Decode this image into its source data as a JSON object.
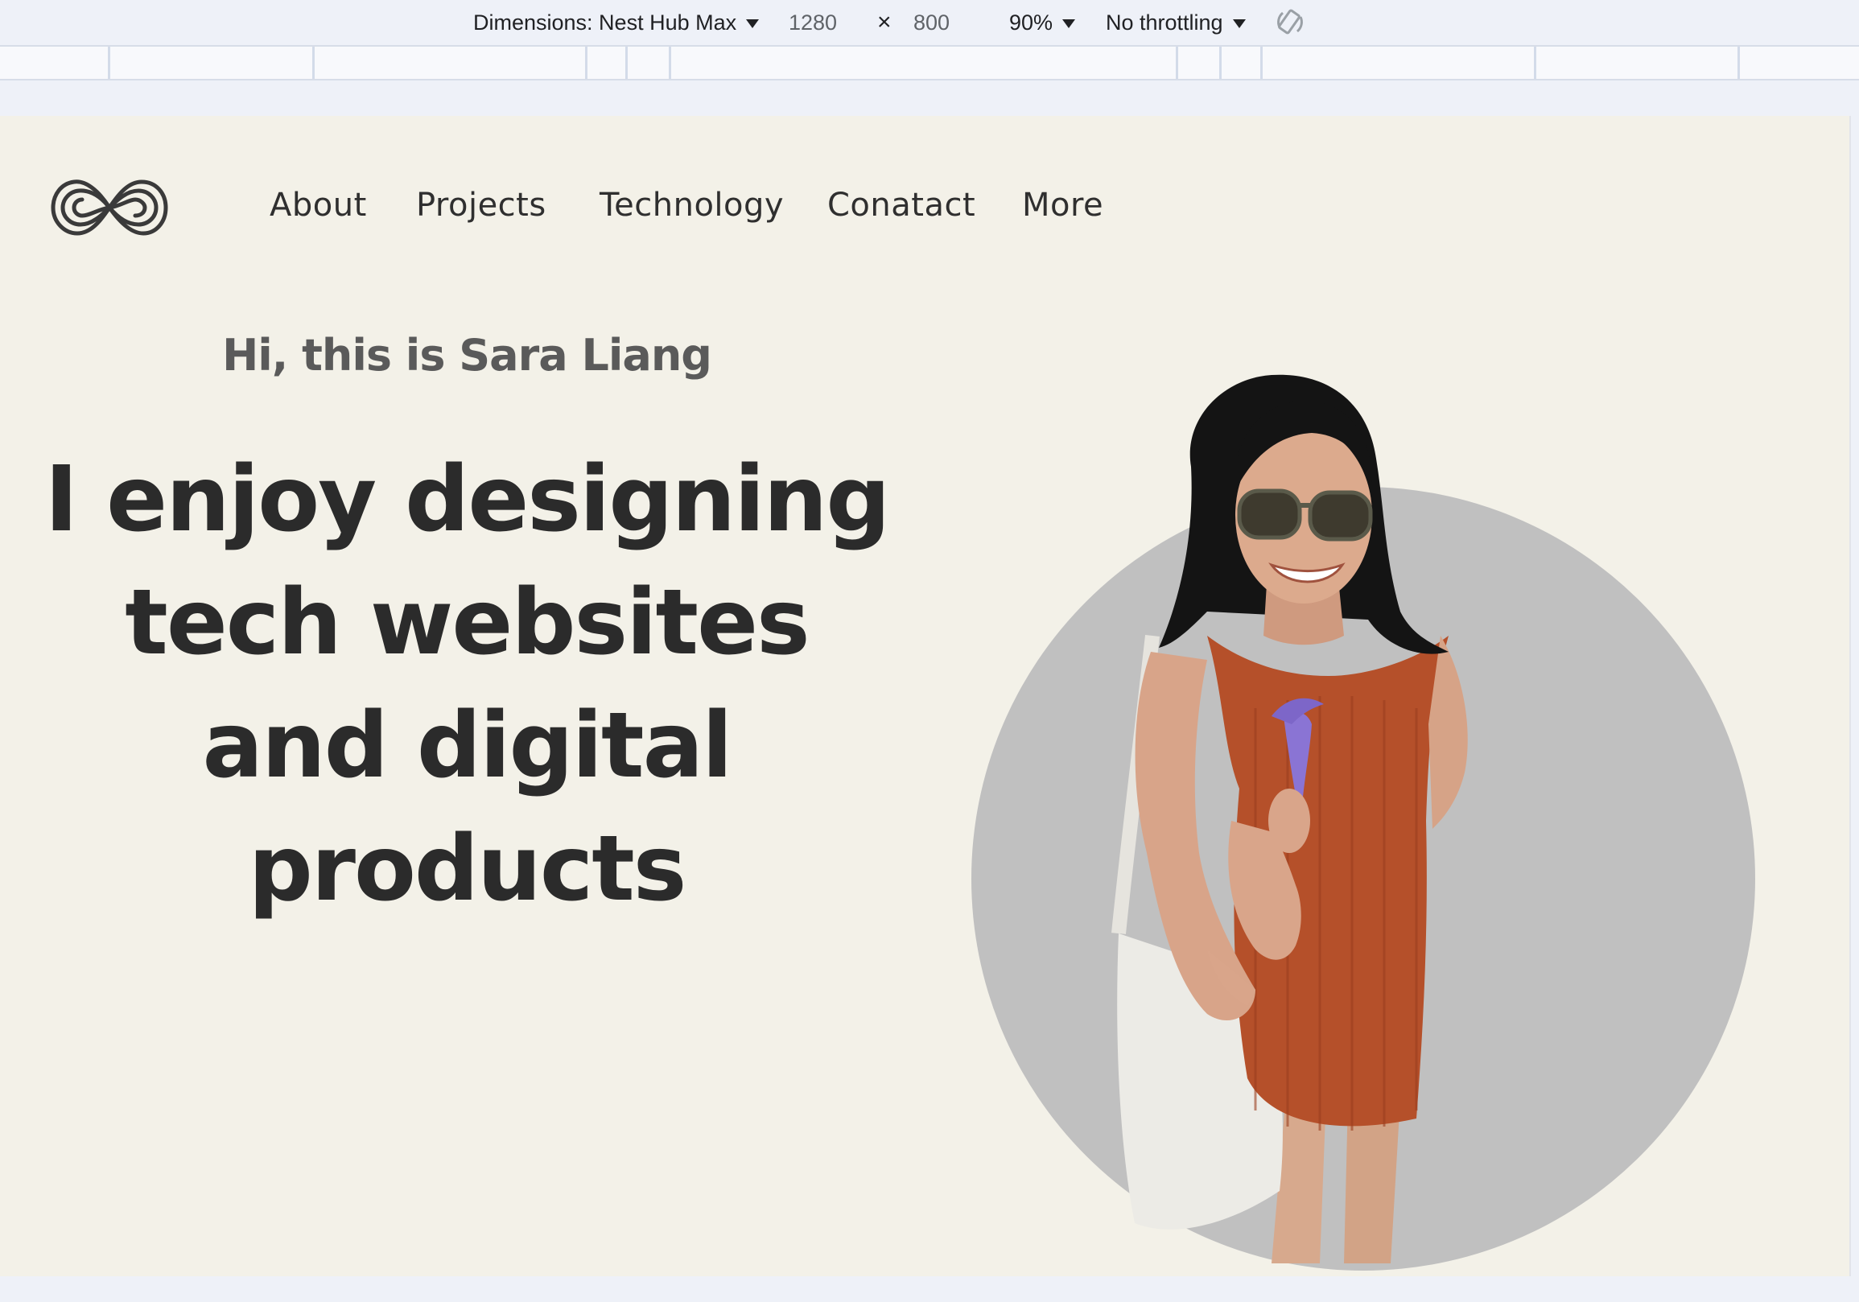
{
  "devtools": {
    "dimensions_label": "Dimensions: Nest Hub Max",
    "width": "1280",
    "times": "×",
    "height": "800",
    "zoom": "90%",
    "throttling": "No throttling",
    "rotate_icon": "rotate-icon"
  },
  "site": {
    "logo_icon": "infinity-logo",
    "nav": [
      "About",
      "Projects",
      "Technology",
      "Conatact",
      "More"
    ],
    "greeting": "Hi, this is Sara Liang",
    "headline": [
      "I enjoy designing",
      "tech websites",
      "and digital",
      "products"
    ],
    "portrait": "portrait-photo",
    "colors": {
      "background": "#f3f1e8",
      "circle": "#c0c0c0",
      "text": "#2b2b2b"
    }
  }
}
